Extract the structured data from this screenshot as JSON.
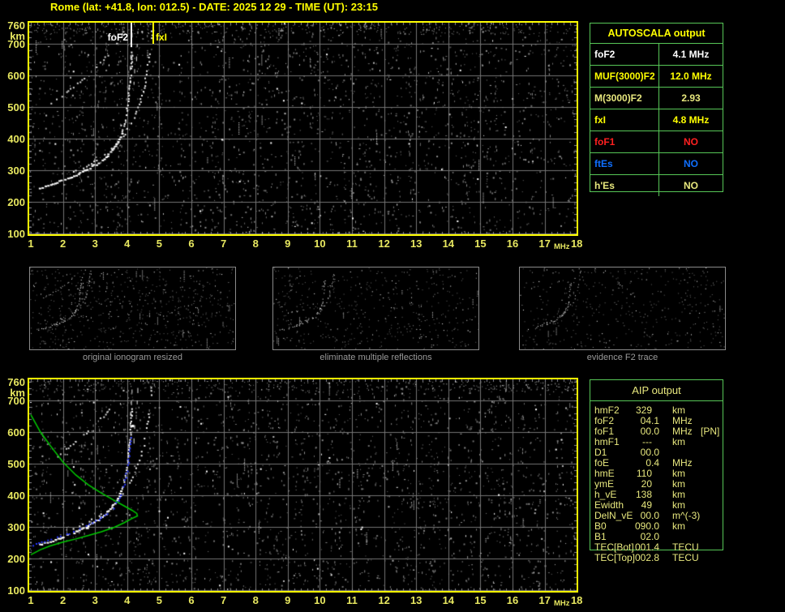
{
  "title": "Rome (lat: +41.8, lon: 012.5) - DATE: 2025 12 29 - TIME (UT): 23:15",
  "colors": {
    "title": "#ffff00",
    "plot_border": "#ffff00",
    "axis_label": "#e8e860",
    "grid": "#757575",
    "table_border": "#57c757",
    "white": "#ffffff",
    "yellow": "#ffff00",
    "khaki": "#e8e87e",
    "red": "#ff2020",
    "blue": "#0f6fff",
    "profile_green": "#00cc00",
    "trace_blue": "#2535ff",
    "caption_gray": "#9a9a9a"
  },
  "plots": {
    "y_unit": "km",
    "x_unit": "MHz",
    "y_ticks": [
      760,
      700,
      600,
      500,
      400,
      300,
      200,
      100
    ],
    "x_ticks": [
      "1",
      "2",
      "3",
      "4",
      "5",
      "6",
      "7",
      "8",
      "9",
      "10",
      "11",
      "12",
      "13",
      "14",
      "15",
      "16",
      "17",
      "18"
    ]
  },
  "top_plot": {
    "markers": {
      "foF2": {
        "label": "foF2",
        "freq": 4.1,
        "color": "#ffffff"
      },
      "fxI": {
        "label": "fxI",
        "freq": 4.8,
        "color": "#ffff00"
      }
    }
  },
  "autoscala_table": {
    "header": "AUTOSCALA output",
    "rows": [
      {
        "label": "foF2",
        "value": "4.1 MHz",
        "hex": "#ffffff"
      },
      {
        "label": "MUF(3000)F2",
        "value": "12.0 MHz",
        "hex": "#ffff00"
      },
      {
        "label": "M(3000)F2",
        "value": "2.93",
        "hex": "#e8e87e"
      },
      {
        "label": "fxI",
        "value": "4.8 MHz",
        "hex": "#ffff00"
      },
      {
        "label": "foF1",
        "value": "NO",
        "hex": "#ff2020"
      },
      {
        "label": "ftEs",
        "value": "NO",
        "hex": "#0f6fff"
      },
      {
        "label": "h'Es",
        "value": "NO",
        "hex": "#e8e87e"
      }
    ]
  },
  "panels": [
    {
      "caption": "original ionogram resized"
    },
    {
      "caption": "eliminate multiple reflections"
    },
    {
      "caption": "evidence F2 trace"
    }
  ],
  "aip_table": {
    "header": "AIP output",
    "rows": [
      {
        "label": "hmF2",
        "value": "329",
        "unit": "km",
        "extra": ""
      },
      {
        "label": "foF2",
        "value": "04.1",
        "unit": "MHz",
        "extra": ""
      },
      {
        "label": "foF1",
        "value": "00.0",
        "unit": "MHz",
        "extra": "[PN]"
      },
      {
        "label": "hmF1",
        "value": "---",
        "unit": "km",
        "extra": ""
      },
      {
        "label": "D1",
        "value": "00.0",
        "unit": "",
        "extra": ""
      },
      {
        "label": "foE",
        "value": "0.4",
        "unit": "MHz",
        "extra": ""
      },
      {
        "label": "hmE",
        "value": "110",
        "unit": "km",
        "extra": ""
      },
      {
        "label": "ymE",
        "value": "20",
        "unit": "km",
        "extra": ""
      },
      {
        "label": "h_vE",
        "value": "138",
        "unit": "km",
        "extra": ""
      },
      {
        "label": "Ewidth",
        "value": "49",
        "unit": "km",
        "extra": ""
      },
      {
        "label": "DelN_vE",
        "value": "00.0",
        "unit": "m^(-3)",
        "extra": ""
      },
      {
        "label": "B0",
        "value": "090.0",
        "unit": "km",
        "extra": ""
      },
      {
        "label": "B1",
        "value": "02.0",
        "unit": "",
        "extra": ""
      },
      {
        "label": "TEC[Bot]",
        "value": "001.4",
        "unit": "TECU",
        "extra": ""
      },
      {
        "label": "TEC[Top]",
        "value": "002.8",
        "unit": "TECU",
        "extra": ""
      }
    ]
  },
  "chart_data": {
    "type": "scatter",
    "title": "Ionogram, Rome 2025-12-29 23:15 UT",
    "x_label": "MHz",
    "y_label": "km",
    "x_range": [
      1,
      18
    ],
    "y_range": [
      100,
      760
    ],
    "foF2_MHz": 4.1,
    "fxI_MHz": 4.8,
    "MUF3000F2_MHz": 12.0,
    "M3000F2": 2.93,
    "hmF2_km": 329,
    "o_trace": [
      [
        1.25,
        245
      ],
      [
        1.5,
        252
      ],
      [
        1.75,
        260
      ],
      [
        2.0,
        270
      ],
      [
        2.25,
        280
      ],
      [
        2.5,
        292
      ],
      [
        2.75,
        305
      ],
      [
        3.0,
        320
      ],
      [
        3.2,
        334
      ],
      [
        3.4,
        352
      ],
      [
        3.55,
        370
      ],
      [
        3.7,
        392
      ],
      [
        3.8,
        415
      ],
      [
        3.9,
        450
      ],
      [
        3.97,
        490
      ],
      [
        4.02,
        530
      ],
      [
        4.06,
        570
      ],
      [
        4.09,
        610
      ],
      [
        4.11,
        645
      ],
      [
        4.13,
        680
      ]
    ],
    "second_hop": [
      [
        1.5,
        505
      ],
      [
        1.7,
        518
      ],
      [
        1.9,
        532
      ],
      [
        2.1,
        548
      ],
      [
        2.3,
        564
      ],
      [
        2.5,
        581
      ],
      [
        2.7,
        599
      ],
      [
        2.9,
        617
      ],
      [
        3.1,
        637
      ],
      [
        3.3,
        658
      ],
      [
        3.5,
        680
      ],
      [
        3.65,
        702
      ],
      [
        3.8,
        724
      ],
      [
        3.92,
        748
      ]
    ],
    "asym_dashes": [
      [
        4.05,
        565
      ],
      [
        4.06,
        595
      ],
      [
        4.08,
        630
      ],
      [
        4.1,
        665
      ],
      [
        4.12,
        700
      ],
      [
        4.14,
        735
      ],
      [
        4.2,
        580
      ],
      [
        4.22,
        620
      ],
      [
        4.28,
        660
      ],
      [
        4.3,
        700
      ],
      [
        4.32,
        740
      ]
    ],
    "x_trace": [
      [
        2.3,
        295
      ],
      [
        2.7,
        315
      ],
      [
        3.1,
        338
      ],
      [
        3.5,
        368
      ],
      [
        3.8,
        400
      ],
      [
        4.0,
        432
      ],
      [
        4.2,
        470
      ],
      [
        4.35,
        510
      ],
      [
        4.5,
        560
      ],
      [
        4.6,
        615
      ],
      [
        4.68,
        670
      ],
      [
        4.73,
        720
      ],
      [
        4.76,
        755
      ]
    ],
    "blue_scaled_trace": [
      [
        1.05,
        243
      ],
      [
        1.3,
        251
      ],
      [
        1.6,
        259
      ],
      [
        1.9,
        271
      ],
      [
        2.2,
        281
      ],
      [
        2.5,
        296
      ],
      [
        2.8,
        310
      ],
      [
        3.1,
        327
      ],
      [
        3.35,
        343
      ],
      [
        3.55,
        362
      ],
      [
        3.7,
        385
      ],
      [
        3.82,
        410
      ],
      [
        3.92,
        448
      ],
      [
        3.99,
        488
      ],
      [
        4.04,
        528
      ],
      [
        4.07,
        562
      ],
      [
        4.1,
        592
      ]
    ],
    "green_profile": [
      [
        1.0,
        655
      ],
      [
        1.3,
        600
      ],
      [
        1.6,
        558
      ],
      [
        2.0,
        505
      ],
      [
        2.4,
        464
      ],
      [
        2.8,
        432
      ],
      [
        3.2,
        406
      ],
      [
        3.6,
        383
      ],
      [
        3.9,
        366
      ],
      [
        4.15,
        352
      ],
      [
        4.3,
        342
      ],
      [
        4.32,
        334
      ],
      [
        4.15,
        326
      ],
      [
        3.9,
        312
      ],
      [
        3.6,
        298
      ],
      [
        3.2,
        284
      ],
      [
        2.8,
        272
      ],
      [
        2.4,
        261
      ],
      [
        2.0,
        251
      ],
      [
        1.6,
        239
      ],
      [
        1.3,
        227
      ],
      [
        1.0,
        211
      ]
    ]
  }
}
